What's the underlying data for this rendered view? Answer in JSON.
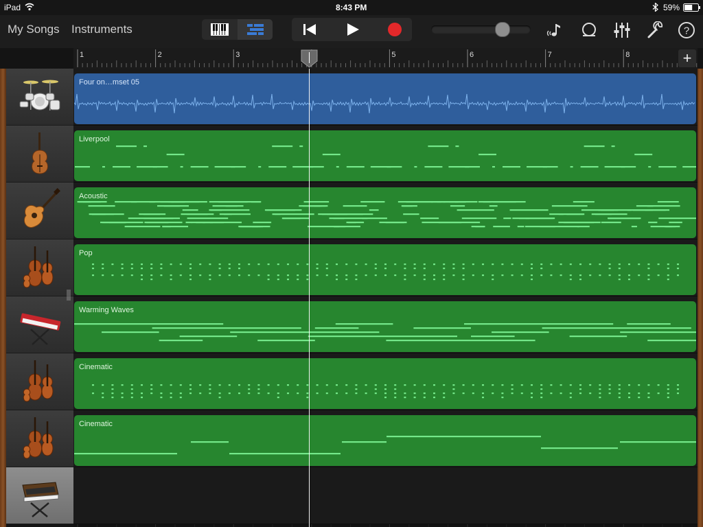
{
  "status": {
    "device": "iPad",
    "time": "8:43 PM",
    "battery": "59%"
  },
  "nav": {
    "my_songs": "My Songs",
    "instruments": "Instruments"
  },
  "view_toggle": {
    "keyboard_icon": "piano-keyboard-icon",
    "tracks_icon": "tracks-view-icon",
    "active": "tracks"
  },
  "transport": {
    "rewind_icon": "rewind-icon",
    "play_icon": "play-icon",
    "record_icon": "record-icon"
  },
  "volume": {
    "level": 0.72
  },
  "tools": [
    "note-settings-icon",
    "loop-browser-icon",
    "mixer-icon",
    "settings-wrench-icon",
    "help-icon"
  ],
  "ruler": {
    "bars": [
      "1",
      "2",
      "3",
      "4",
      "5",
      "6",
      "7",
      "8"
    ],
    "add_label": "+"
  },
  "playhead": {
    "bar": 4
  },
  "tracks": [
    {
      "instrument": "drum-kit-icon",
      "region": "Four on…mset 05",
      "color": "blue",
      "kind": "audio"
    },
    {
      "instrument": "upright-bass-icon",
      "region": "Liverpool",
      "color": "green",
      "kind": "bass"
    },
    {
      "instrument": "acoustic-guitar-icon",
      "region": "Acoustic",
      "color": "green",
      "kind": "dense"
    },
    {
      "instrument": "strings-icon",
      "region": "Pop",
      "color": "green",
      "kind": "stacc"
    },
    {
      "instrument": "synth-keyboard-icon",
      "region": "Warming Waves",
      "color": "green",
      "kind": "pad"
    },
    {
      "instrument": "strings-icon",
      "region": "Cinematic",
      "color": "green",
      "kind": "stacc2"
    },
    {
      "instrument": "strings-icon",
      "region": "Cinematic",
      "color": "green",
      "kind": "sus"
    },
    {
      "instrument": "analog-synth-icon",
      "region": "",
      "color": "",
      "kind": "empty",
      "selected": true
    }
  ]
}
